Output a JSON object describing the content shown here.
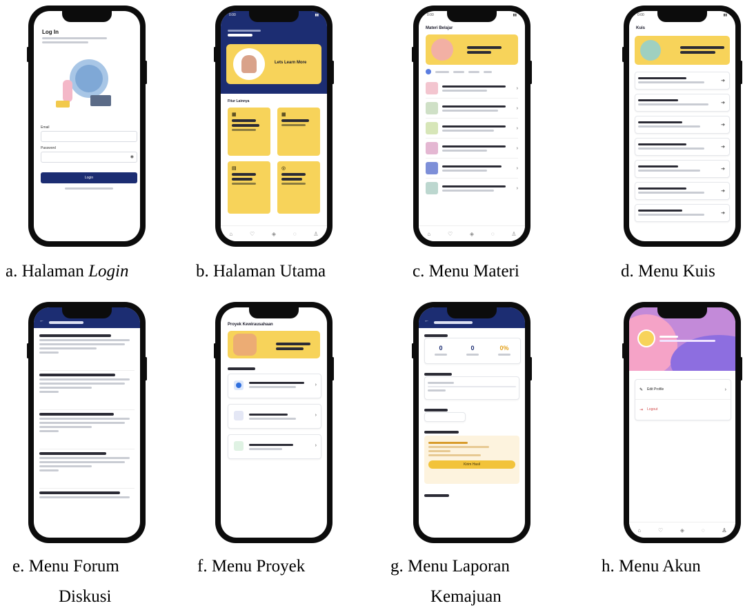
{
  "captions": {
    "a_prefix": "a. Halaman ",
    "a_italic": "Login",
    "b": "b.  Halaman Utama",
    "c": "c.  Menu Materi",
    "d": "d.   Menu Kuis",
    "e": "e.   Menu Forum",
    "e2": "Diskusi",
    "f": "f.   Menu Proyek",
    "g": "g.   Menu Laporan",
    "g2": "Kemajuan",
    "h": "h.   Menu Akun"
  },
  "login": {
    "title": "Log In",
    "email_label": "Email",
    "password_label": "Password",
    "button": "Login"
  },
  "home": {
    "banner": "Lets Learn More",
    "section": "Fitur Lainnya"
  },
  "materi": {
    "title": "Materi Belajar"
  },
  "kuis": {
    "title": "Kuis"
  },
  "proyek": {
    "title": "Proyek Kewirausahaan"
  },
  "laporan": {
    "stat_values": [
      "0",
      "0",
      "0%"
    ],
    "button": "Kirim Hasil"
  },
  "akun": {
    "menu": [
      "Edit Profile",
      "Logout"
    ]
  },
  "colors": {
    "navy": "#1c2d72",
    "yellow": "#f7d35a"
  }
}
